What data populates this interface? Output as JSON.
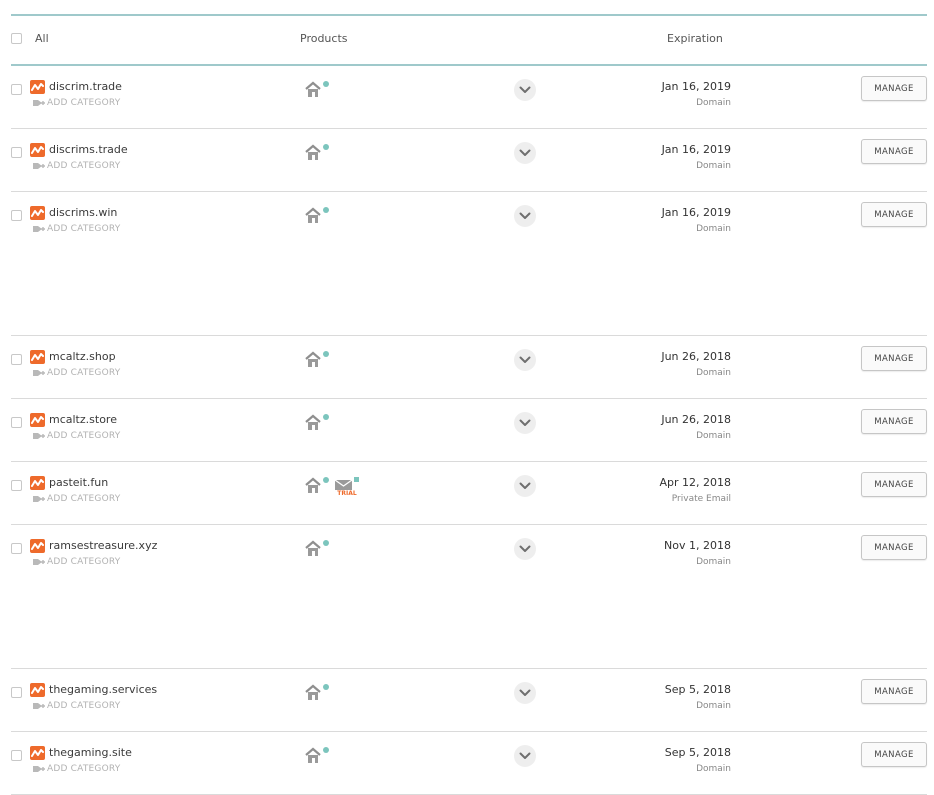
{
  "header": {
    "all_label": "All",
    "products_label": "Products",
    "expiration_label": "Expiration"
  },
  "colors": {
    "accent_teal": "#9fc9cb",
    "brand_orange": "#ee6a2b",
    "product_dot": "#7cc5bd"
  },
  "labels": {
    "add_category": "ADD CATEGORY",
    "manage": "MANAGE",
    "trial": "TRIAL"
  },
  "rows": [
    {
      "domain": "discrim.trade",
      "date": "Jan 16, 2019",
      "type": "Domain",
      "products": [
        "website-builder-icon"
      ]
    },
    {
      "domain": "discrims.trade",
      "date": "Jan 16, 2019",
      "type": "Domain",
      "products": [
        "website-builder-icon"
      ]
    },
    {
      "domain": "discrims.win",
      "date": "Jan 16, 2019",
      "type": "Domain",
      "products": [
        "website-builder-icon"
      ]
    },
    {
      "domain": "mcaltz.shop",
      "date": "Jun 26, 2018",
      "type": "Domain",
      "products": [
        "website-builder-icon"
      ]
    },
    {
      "domain": "mcaltz.store",
      "date": "Jun 26, 2018",
      "type": "Domain",
      "products": [
        "website-builder-icon"
      ]
    },
    {
      "domain": "pasteit.fun",
      "date": "Apr 12, 2018",
      "type": "Private Email",
      "products": [
        "website-builder-icon",
        "mail-icon"
      ]
    },
    {
      "domain": "ramsestreasure.xyz",
      "date": "Nov 1, 2018",
      "type": "Domain",
      "products": [
        "website-builder-icon"
      ]
    },
    {
      "domain": "thegaming.services",
      "date": "Sep 5, 2018",
      "type": "Domain",
      "products": [
        "website-builder-icon"
      ]
    },
    {
      "domain": "thegaming.site",
      "date": "Sep 5, 2018",
      "type": "Domain",
      "products": [
        "website-builder-icon"
      ]
    }
  ]
}
